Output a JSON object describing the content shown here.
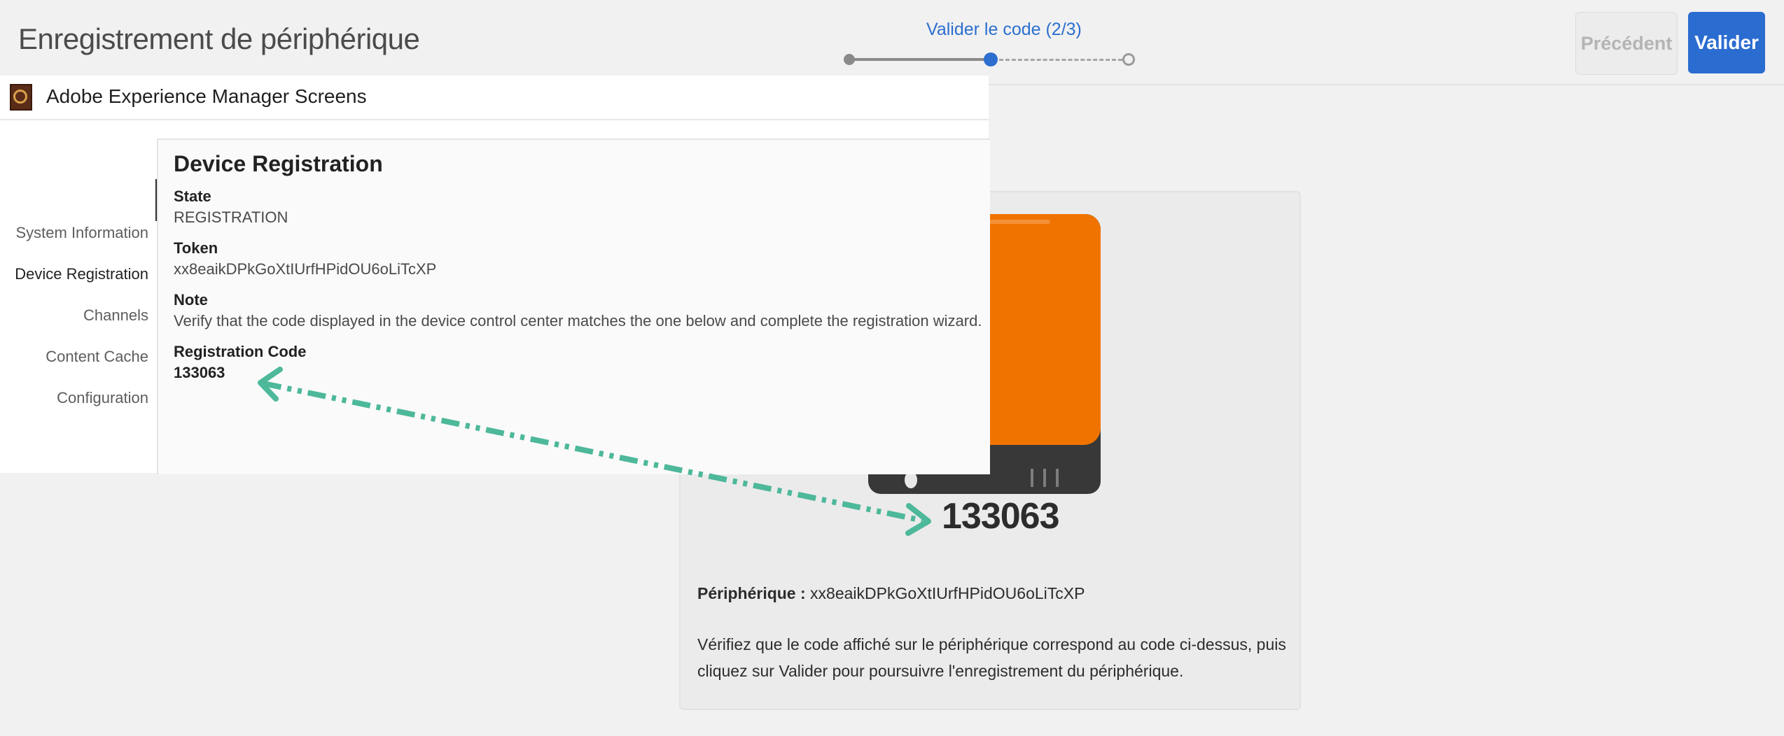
{
  "header": {
    "title": "Enregistrement de périphérique",
    "step_label": "Valider le code (2/3)",
    "previous_label": "Précédent",
    "validate_label": "Valider"
  },
  "stepper": {
    "current_step": 2,
    "total_steps": 3,
    "active_color": "#2c6fcf"
  },
  "card": {
    "code": "133063",
    "device_label": "Périphérique :",
    "device_id": "xx8eaikDPkGoXtIUrfHPidOU6oLiTcXP",
    "instructions": "Vérifiez que le code affiché sur le périphérique correspond au code ci-dessus, puis cliquez sur Valider pour poursuivre l'enregistrement du périphérique.",
    "screen_color": "#f07300"
  },
  "player": {
    "title": "Adobe Experience Manager Screens",
    "nav": [
      {
        "label": "System Information"
      },
      {
        "label": "Device Registration"
      },
      {
        "label": "Channels"
      },
      {
        "label": "Content Cache"
      },
      {
        "label": "Configuration"
      }
    ],
    "active_nav": "Device Registration",
    "panel": {
      "title": "Device Registration",
      "state_label": "State",
      "state_value": "REGISTRATION",
      "token_label": "Token",
      "token_value": "xx8eaikDPkGoXtIUrfHPidOU6oLiTcXP",
      "note_label": "Note",
      "note_value": "Verify that the code displayed in the device control center matches the one below and complete the registration wizard.",
      "code_label": "Registration Code",
      "code_value": "133063"
    }
  },
  "annotation": {
    "arrow_color": "#4db89a",
    "style": "dash-dot double-headed arrow"
  }
}
